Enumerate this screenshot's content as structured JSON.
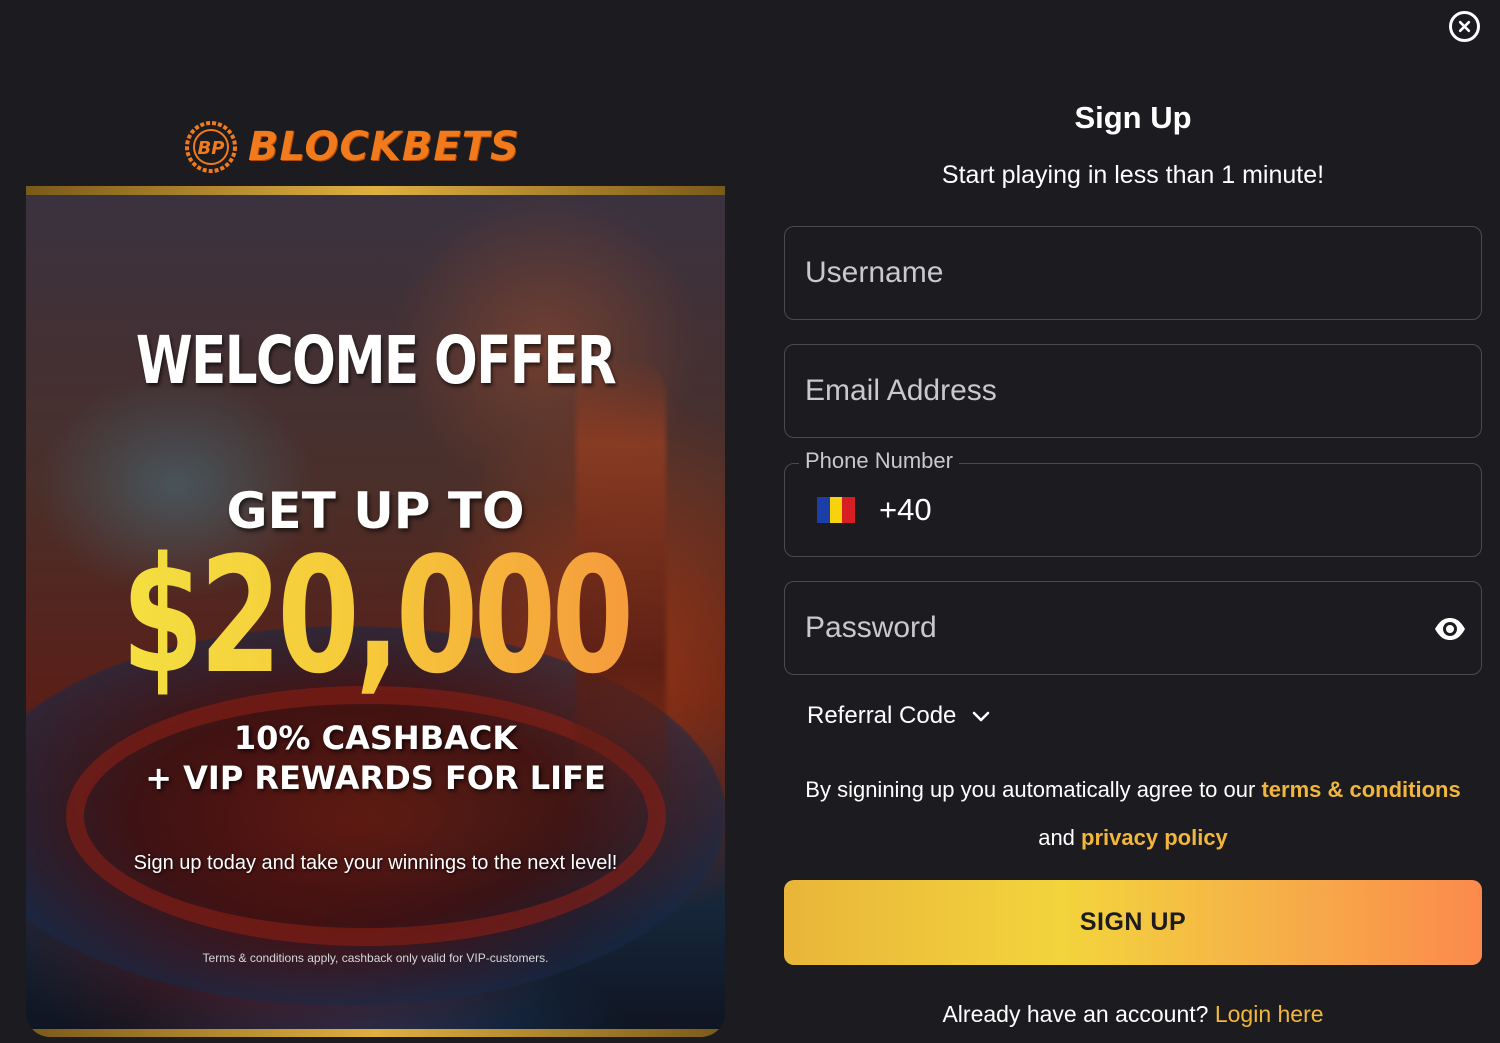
{
  "brand": {
    "name": "BLOCKBETS",
    "color": "#f07a1c"
  },
  "promo": {
    "headline": "WELCOME OFFER",
    "get_up_to": "GET UP TO",
    "amount": "$20,000",
    "cashback_line1": "10% CASHBACK",
    "cashback_line2": "+ VIP REWARDS FOR LIFE",
    "tagline": "Sign up today and take your winnings to the next level!",
    "terms_note": "Terms & conditions apply, cashback only valid for VIP-customers."
  },
  "form": {
    "title": "Sign Up",
    "subtitle": "Start playing in less than 1 minute!",
    "username_placeholder": "Username",
    "email_placeholder": "Email Address",
    "phone_label": "Phone Number",
    "phone_code": "+40",
    "phone_flag": "romania-flag",
    "password_placeholder": "Password",
    "referral_label": "Referral Code",
    "agree_prefix": "By signining up you automatically agree to our",
    "terms_link": "terms & conditions",
    "agree_and": "and",
    "privacy_link": "privacy policy",
    "signup_button": "SIGN UP",
    "have_account": "Already have an account?",
    "login_link": "Login here"
  },
  "colors": {
    "background": "#1b1b20",
    "accent": "#f2b73a",
    "button_gradient_start": "#e9b53a",
    "button_gradient_end": "#fb8a4c",
    "field_border": "#4a4a50"
  },
  "icons": {
    "close": "close-circle-icon",
    "eye": "eye-icon",
    "chevron": "chevron-down-icon",
    "logo": "blockbets-logo-icon"
  }
}
